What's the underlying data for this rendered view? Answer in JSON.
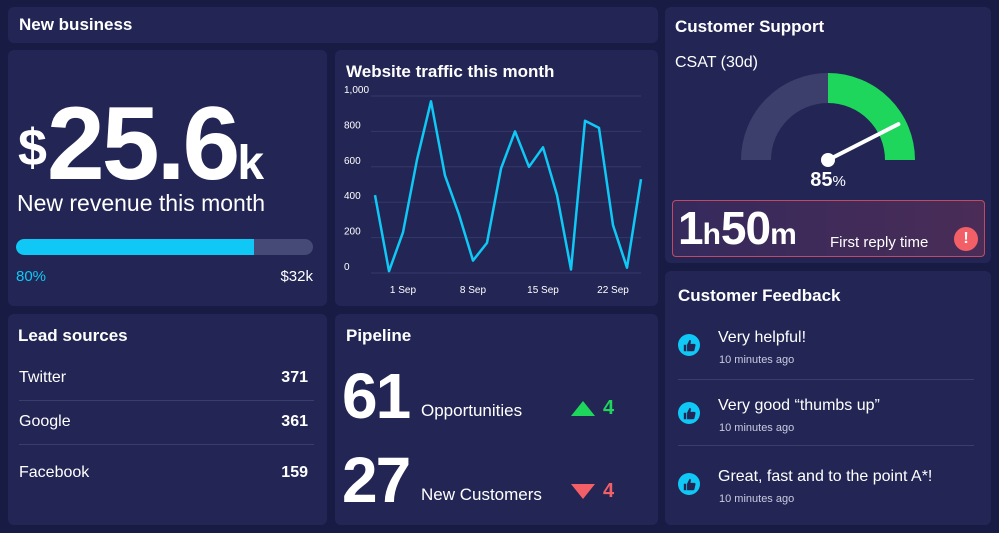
{
  "new_business": {
    "title": "New business"
  },
  "revenue": {
    "currency": "$",
    "amount": "25.6",
    "suffix": "k",
    "label": "New revenue this month",
    "progress_fraction": 0.8,
    "progress_label": "80%",
    "target_label": "$32k",
    "bar_color": "#10c8f5"
  },
  "traffic": {
    "title": "Website traffic this month",
    "chart_data": {
      "type": "line",
      "x": [
        1,
        2,
        3,
        4,
        5,
        6,
        7,
        8,
        9,
        10,
        11,
        12,
        13,
        14,
        15,
        16,
        17,
        18,
        19,
        20,
        21,
        22,
        23
      ],
      "xticks": [
        "1 Sep",
        "8 Sep",
        "15 Sep",
        "22 Sep"
      ],
      "xtick_positions": [
        2,
        7,
        12,
        17
      ],
      "yticks": [
        "0",
        "200",
        "400",
        "600",
        "800",
        "1,000"
      ],
      "ylim": [
        0,
        1000
      ],
      "series": [
        {
          "color": "#10c8f5",
          "values": [
            440,
            10,
            230,
            640,
            970,
            550,
            330,
            70,
            170,
            590,
            800,
            600,
            710,
            440,
            20,
            860,
            820,
            270,
            30,
            530
          ]
        }
      ],
      "grid": true
    }
  },
  "leads": {
    "title": "Lead sources",
    "rows": [
      {
        "name": "Twitter",
        "value": "371"
      },
      {
        "name": "Google",
        "value": "361"
      },
      {
        "name": "Facebook",
        "value": "159"
      }
    ]
  },
  "pipeline": {
    "title": "Pipeline",
    "opportunities": {
      "count": "61",
      "label": "Opportunities",
      "delta": "4",
      "direction": "up",
      "color": "#1dd65b"
    },
    "customers": {
      "count": "27",
      "label": "New Customers",
      "delta": "4",
      "direction": "down",
      "color": "#f25f67"
    }
  },
  "support": {
    "title": "Customer Support",
    "csat_label": "CSAT (30d)",
    "csat_value": "85",
    "csat_unit": "%",
    "csat_fraction": 0.85,
    "gauge_green": "#1dd65b",
    "reply_hours": "1",
    "reply_h": "h",
    "reply_minutes": "50",
    "reply_m": "m",
    "reply_label": "First reply time",
    "alert_icon": "!"
  },
  "feedback": {
    "title": "Customer Feedback",
    "items": [
      {
        "icon": "thumbs-up-icon",
        "text": "Very helpful!",
        "time": "10 minutes ago"
      },
      {
        "icon": "thumbs-up-icon",
        "text": "Very good “thumbs up”",
        "time": "10 minutes ago"
      },
      {
        "icon": "thumbs-up-icon",
        "text": "Great, fast and to the point A*!",
        "time": "10 minutes ago"
      }
    ]
  }
}
